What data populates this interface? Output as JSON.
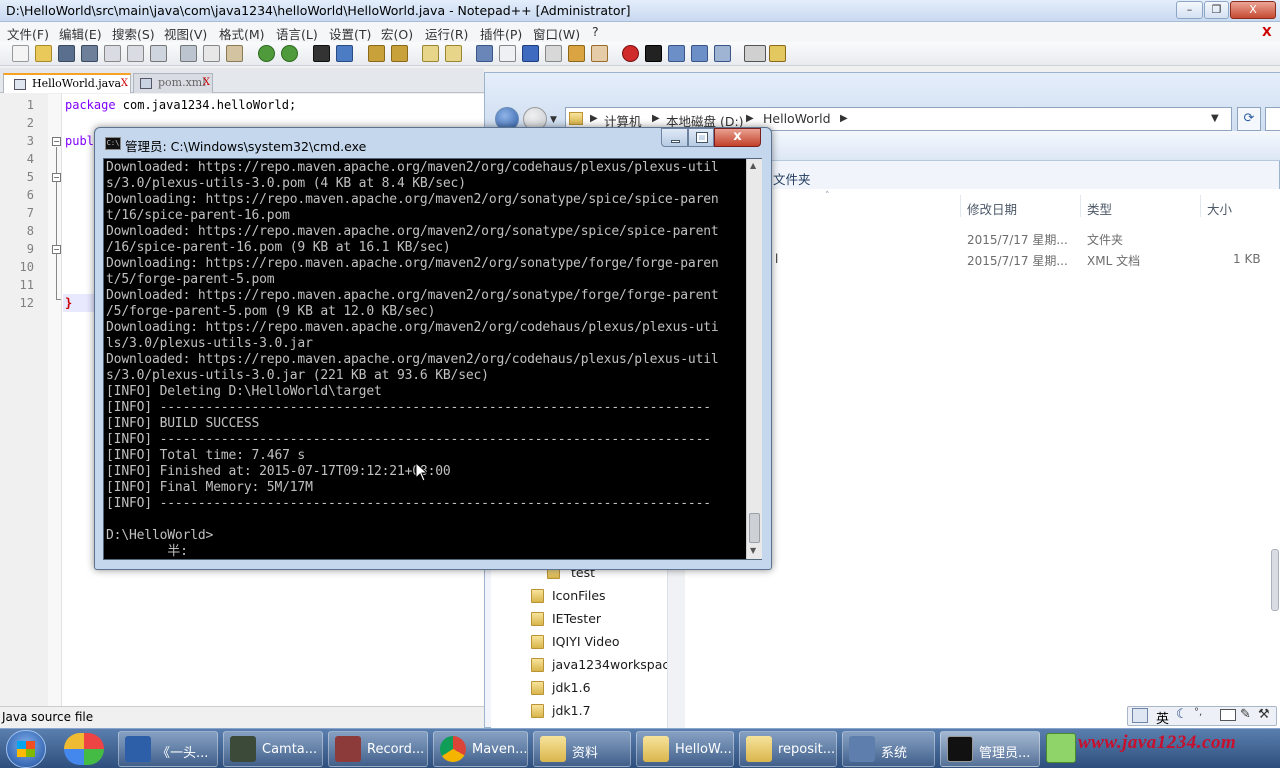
{
  "npp": {
    "title": "D:\\HelloWorld\\src\\main\\java\\com\\java1234\\helloWorld\\HelloWorld.java - Notepad++ [Administrator]",
    "menu": [
      "文件(F)",
      "编辑(E)",
      "搜索(S)",
      "视图(V)",
      "格式(M)",
      "语言(L)",
      "设置(T)",
      "宏(O)",
      "运行(R)",
      "插件(P)",
      "窗口(W)",
      "?"
    ],
    "close_x": "X",
    "tabs": [
      "HelloWorld.java",
      "pom.xml"
    ],
    "lines": [
      "1",
      "2",
      "3",
      "4",
      "5",
      "6",
      "7",
      "8",
      "9",
      "10",
      "11",
      "12"
    ],
    "code": {
      "keyword": "package",
      "package": " com.java1234.helloWorld;",
      "line3": "publ",
      "line12": "}"
    },
    "status": "Java source file"
  },
  "explorer": {
    "breadcrumbs": [
      "计算机",
      "本地磁盘 (D:)",
      "HelloWorld"
    ],
    "new_folder": "文件夹",
    "columns": [
      "修改日期",
      "类型",
      "大小"
    ],
    "rows": [
      {
        "date": "2015/7/17 星期...",
        "type": "文件夹",
        "size": ""
      },
      {
        "date": "2015/7/17 星期...",
        "type": "XML 文档",
        "size": "1 KB"
      }
    ],
    "tree": [
      "test",
      "IconFiles",
      "IETester",
      "IQIYI Video",
      "java1234workspace",
      "jdk1.6",
      "jdk1.7"
    ]
  },
  "cmd": {
    "title": "管理员: C:\\Windows\\system32\\cmd.exe",
    "icon_text": "C:\\",
    "close": "x",
    "lines": [
      "Downloaded: https://repo.maven.apache.org/maven2/org/codehaus/plexus/plexus-util",
      "s/3.0/plexus-utils-3.0.pom (4 KB at 8.4 KB/sec)",
      "Downloading: https://repo.maven.apache.org/maven2/org/sonatype/spice/spice-paren",
      "t/16/spice-parent-16.pom",
      "Downloaded: https://repo.maven.apache.org/maven2/org/sonatype/spice/spice-parent",
      "/16/spice-parent-16.pom (9 KB at 16.1 KB/sec)",
      "Downloading: https://repo.maven.apache.org/maven2/org/sonatype/forge/forge-paren",
      "t/5/forge-parent-5.pom",
      "Downloaded: https://repo.maven.apache.org/maven2/org/sonatype/forge/forge-parent",
      "/5/forge-parent-5.pom (9 KB at 12.0 KB/sec)",
      "Downloading: https://repo.maven.apache.org/maven2/org/codehaus/plexus/plexus-uti",
      "ls/3.0/plexus-utils-3.0.jar",
      "Downloaded: https://repo.maven.apache.org/maven2/org/codehaus/plexus/plexus-util",
      "s/3.0/plexus-utils-3.0.jar (221 KB at 93.6 KB/sec)",
      "[INFO] Deleting D:\\HelloWorld\\target",
      "[INFO] ------------------------------------------------------------------------",
      "[INFO] BUILD SUCCESS",
      "[INFO] ------------------------------------------------------------------------",
      "[INFO] Total time: 7.467 s",
      "[INFO] Finished at: 2015-07-17T09:12:21+08:00",
      "[INFO] Final Memory: 5M/17M",
      "[INFO] ------------------------------------------------------------------------",
      "",
      "D:\\HelloWorld>",
      "        半:"
    ]
  },
  "language_bar": {
    "lang": "英"
  },
  "taskbar": {
    "items": [
      "《一头...",
      "Camta...",
      "Record...",
      "Maven...",
      "资料",
      "HelloW...",
      "reposit...",
      "系统",
      "管理员..."
    ],
    "watermark": "www.java1234.com"
  }
}
